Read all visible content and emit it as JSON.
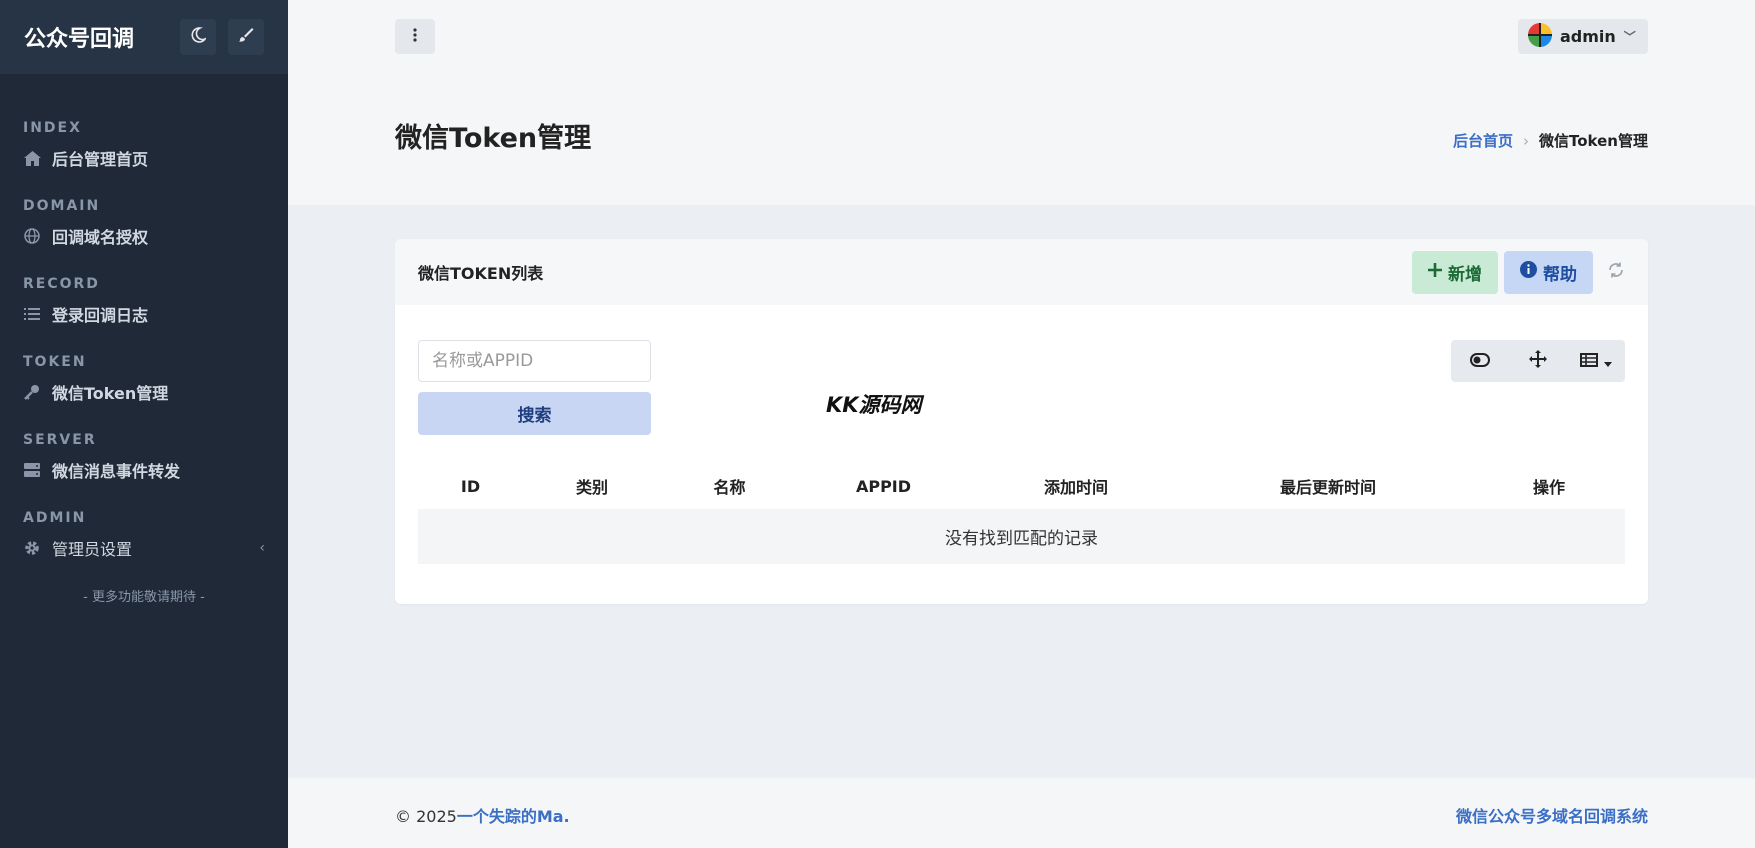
{
  "sidebar": {
    "brand": "公众号回调",
    "sections": [
      {
        "heading": "INDEX",
        "label": "后台管理首页"
      },
      {
        "heading": "DOMAIN",
        "label": "回调域名授权"
      },
      {
        "heading": "RECORD",
        "label": "登录回调日志"
      },
      {
        "heading": "TOKEN",
        "label": "微信Token管理"
      },
      {
        "heading": "SERVER",
        "label": "微信消息事件转发"
      },
      {
        "heading": "ADMIN",
        "label": "管理员设置"
      }
    ],
    "footer": "- 更多功能敬请期待 -"
  },
  "topbar": {
    "user": "admin"
  },
  "header": {
    "title": "微信Token管理",
    "breadcrumb": {
      "home": "后台首页",
      "current": "微信Token管理"
    }
  },
  "card": {
    "title": "微信TOKEN列表",
    "add_label": "新增",
    "help_label": "帮助",
    "search": {
      "placeholder": "名称或APPID",
      "button": "搜索"
    },
    "watermark": "KK源码网",
    "columns": [
      "ID",
      "类别",
      "名称",
      "APPID",
      "添加时间",
      "最后更新时间",
      "操作"
    ],
    "empty": "没有找到匹配的记录"
  },
  "footer": {
    "copyright": "© 2025",
    "author": "一个失踪的Ma.",
    "system": "微信公众号多域名回调系统"
  },
  "colors": {
    "sidebar_bg": "#1f2937",
    "accent": "#3b6fc5",
    "success_bg": "#c9ead4",
    "info_bg": "#c6d6f5"
  }
}
